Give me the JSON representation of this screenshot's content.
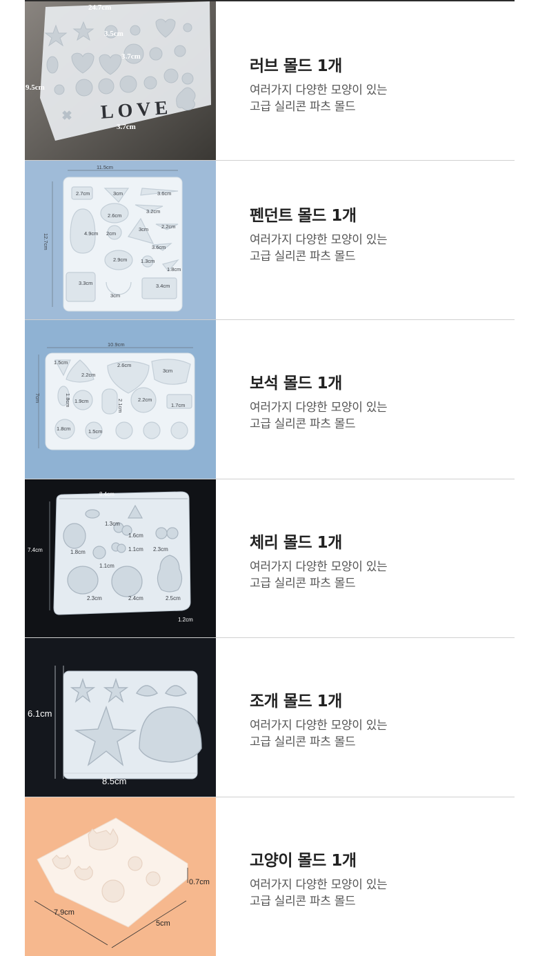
{
  "products": [
    {
      "title": "러브 몰드 1개",
      "desc_line1": "여러가지 다양한 모양이 있는",
      "desc_line2": "고급 실리콘 파츠 몰드",
      "dims": [
        "24.7cm",
        "3.5cm",
        "3.7cm",
        "9.5cm",
        "3.7cm"
      ],
      "mold_text": "LOVE"
    },
    {
      "title": "펜던트 몰드 1개",
      "desc_line1": "여러가지 다양한 모양이 있는",
      "desc_line2": "고급 실리콘 파츠 몰드",
      "dims": [
        "11.5cm",
        "12.7cm",
        "2.7cm",
        "3cm",
        "3.6cm",
        "2.6cm",
        "3.2cm",
        "4.9cm",
        "2cm",
        "3cm",
        "2.2cm",
        "3.6cm",
        "2.9cm",
        "1.3cm",
        "1.8cm",
        "3.3cm",
        "3.4cm",
        "3cm"
      ]
    },
    {
      "title": "보석 몰드 1개",
      "desc_line1": "여러가지 다양한 모양이 있는",
      "desc_line2": "고급 실리콘 파츠 몰드",
      "dims": [
        "10.9cm",
        "7cm",
        "1.5cm",
        "2.2cm",
        "2.6cm",
        "3cm",
        "1.8cm",
        "1.9cm",
        "2.1cm",
        "2.2cm",
        "1.7cm",
        "1.8cm",
        "1.5cm"
      ]
    },
    {
      "title": "체리 몰드 1개",
      "desc_line1": "여러가지 다양한 모양이 있는",
      "desc_line2": "고급 실리콘 파츠 몰드",
      "dims": [
        "8.4cm",
        "7.4cm",
        "1.3cm",
        "1.6cm",
        "1.8cm",
        "1.1cm",
        "2.3cm",
        "1.1cm",
        "2.3cm",
        "2.4cm",
        "2.5cm",
        "1.2cm"
      ]
    },
    {
      "title": "조개 몰드 1개",
      "desc_line1": "여러가지 다양한 모양이 있는",
      "desc_line2": "고급 실리콘 파츠 몰드",
      "dims": [
        "6.1cm",
        "8.5cm"
      ]
    },
    {
      "title": "고양이 몰드 1개",
      "desc_line1": "여러가지 다양한 모양이 있는",
      "desc_line2": "고급 실리콘 파츠 몰드",
      "dims": [
        "0.7cm",
        "7.9cm",
        "5cm"
      ]
    }
  ],
  "colors": {
    "love_bg": "#5e5a55",
    "pendant_bg": "#9fbbd8",
    "gem_bg": "#8fb2d3",
    "cherry_bg": "#101216",
    "shell_bg": "#14171d",
    "cat_bg": "#f6b88e",
    "mold": "#eef3f7"
  }
}
